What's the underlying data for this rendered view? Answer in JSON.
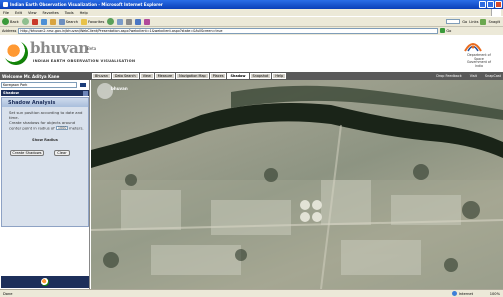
{
  "window": {
    "title": "Indian Earth Observation Visualization - Microsoft Internet Explorer"
  },
  "menu": [
    "File",
    "Edit",
    "View",
    "Favorites",
    "Tools",
    "Help"
  ],
  "toolbar": {
    "back_label": "Back",
    "search_label": "Search",
    "favorites_label": "Favorites",
    "links_label": "Go",
    "links_text": "Links",
    "snagit_label": "SnagIt"
  },
  "address": {
    "label": "Address",
    "url": "http://bhuvan2.nrsc.gov.in/bhuvan/WebClient/Presentation.aspx?webclient=1&webclient.aspx?state=&fullScreen=true",
    "go_label": "Go"
  },
  "banner": {
    "logo_text": "bhuvan",
    "logo_beta": "Beta",
    "logo_subtitle": "INDIAN EARTH OBSERVATION VISUALISATION",
    "isro_text": "Department of Space Government of India"
  },
  "nav": {
    "welcome": "Welcome Mr. Aditya Kane",
    "tabs": [
      "Bhuvan",
      "Data Search",
      "View",
      "Measure",
      "Navigation Map",
      "Places",
      "Shadow",
      "Snapshot",
      "Help"
    ],
    "active_tab": "Shadow",
    "links": [
      "Drop Feedback",
      "Visit",
      "SnapCast"
    ]
  },
  "left": {
    "search_value": "Koregaon Park",
    "header_label": "Shadow",
    "panel_title": "Shadow Analysis",
    "text1": "Set sun position according to date and time.",
    "text2_prefix": "Create shadows for objects around center point in radius of",
    "radius_value": "1000",
    "text2_suffix": "meters.",
    "radius_label": "Show Radius",
    "create_button": "Create Shadows",
    "clear_button": "Clear"
  },
  "map": {
    "watermark": "bhuvan"
  },
  "status": {
    "left": "Done",
    "zone": "Internet",
    "zoom": "100%"
  }
}
